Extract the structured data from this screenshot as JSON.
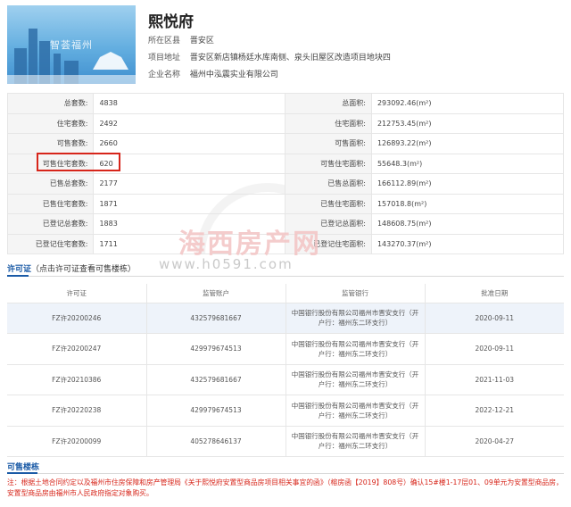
{
  "project": {
    "name": "熙悦府",
    "district_label": "所在区县",
    "district": "晋安区",
    "address_label": "项目地址",
    "address": "晋安区新店镇杨廷水库南侧、泉头旧屋区改造项目地块四",
    "company_label": "企业名称",
    "company": "福州中泓震实业有限公司",
    "image_watermark": "智荟福州"
  },
  "stats": [
    {
      "l1": "总套数:",
      "v1": "4838",
      "l2": "总面积:",
      "v2": "293092.46(m²)"
    },
    {
      "l1": "住宅套数:",
      "v1": "2492",
      "l2": "住宅面积:",
      "v2": "212753.45(m²)"
    },
    {
      "l1": "可售套数:",
      "v1": "2660",
      "l2": "可售面积:",
      "v2": "126893.22(m²)"
    },
    {
      "l1": "可售住宅套数:",
      "v1": "620",
      "l2": "可售住宅面积:",
      "v2": "55648.3(m²)"
    },
    {
      "l1": "已售总套数:",
      "v1": "2177",
      "l2": "已售总面积:",
      "v2": "166112.89(m²)"
    },
    {
      "l1": "已售住宅套数:",
      "v1": "1871",
      "l2": "已售住宅面积:",
      "v2": "157018.8(m²)"
    },
    {
      "l1": "已登记总套数:",
      "v1": "1883",
      "l2": "已登记总面积:",
      "v2": "148608.75(m²)"
    },
    {
      "l1": "已登记住宅套数:",
      "v1": "1711",
      "l2": "已登记住宅面积:",
      "v2": "143270.37(m²)"
    }
  ],
  "watermark": {
    "cn": "海西房产网",
    "url": "www.h0591.com"
  },
  "permits_section": {
    "title": "许可证",
    "hint": "（点击许可证查看可售楼栋）"
  },
  "permits_table": {
    "headers": [
      "许可证",
      "监管账户",
      "监管银行",
      "批准日期"
    ],
    "rows": [
      {
        "permit": "FZ许20200246",
        "account": "432579681667",
        "bank": "中国银行股份有限公司福州市晋安支行（开户行：福州东二环支行）",
        "date": "2020-09-11"
      },
      {
        "permit": "FZ许20200247",
        "account": "429979674513",
        "bank": "中国银行股份有限公司福州市晋安支行（开户行：福州东二环支行）",
        "date": "2020-09-11"
      },
      {
        "permit": "FZ许20210386",
        "account": "432579681667",
        "bank": "中国银行股份有限公司福州市晋安支行（开户行：福州东二环支行）",
        "date": "2021-11-03"
      },
      {
        "permit": "FZ许20220238",
        "account": "429979674513",
        "bank": "中国银行股份有限公司福州市晋安支行（开户行：福州东二环支行）",
        "date": "2022-12-21"
      },
      {
        "permit": "FZ许20200099",
        "account": "405278646137",
        "bank": "中国银行股份有限公司福州市晋安支行（开户行：福州东二环支行）",
        "date": "2020-04-27"
      }
    ]
  },
  "buildings_section": {
    "title": "可售楼栋"
  },
  "note": "注：根据土地合同约定以及福州市住房保障和房产管理局《关于熙悦府安置型商品房项目相关事宜的函》（榕房函【2019】808号）确认15#楼1-17层01、09单元为安置型商品房，安置型商品房由福州市人民政府指定对象购买。",
  "colors": {
    "accent": "#1a5aa6",
    "highlight": "#d7251a",
    "note": "#d7251a"
  }
}
